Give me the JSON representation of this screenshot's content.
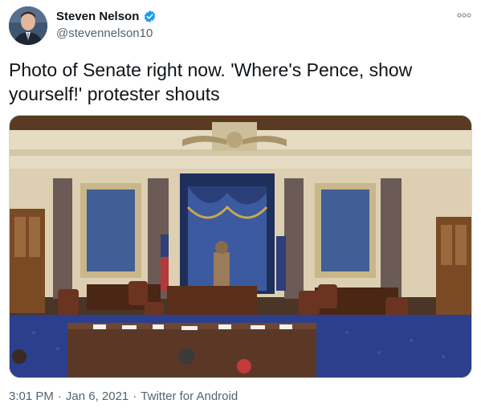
{
  "author": {
    "display_name": "Steven Nelson",
    "handle": "@stevennelson10",
    "verified": true
  },
  "tweet": {
    "text": "Photo of Senate right now. 'Where's Pence, show yourself!' protester shouts"
  },
  "meta": {
    "time": "3:01 PM",
    "separator": "·",
    "date": "Jan 6, 2021",
    "source": "Twitter for Android"
  },
  "icons": {
    "verified": "verified-badge-icon",
    "more": "more-options-icon"
  },
  "colors": {
    "verified_blue": "#1d9bf0",
    "secondary_text": "#536471",
    "primary_text": "#0f1419"
  }
}
